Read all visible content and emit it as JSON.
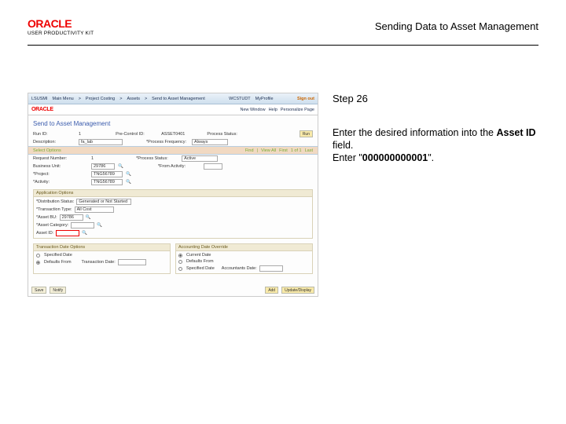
{
  "header": {
    "brand": "ORACLE",
    "product": "USER PRODUCTIVITY KIT",
    "doc_title": "Sending Data to Asset Management"
  },
  "instruction": {
    "step_label": "Step 26",
    "line1": "Enter the desired information into the ",
    "bold_field": "Asset ID",
    "line1_tail": " field.",
    "line2_pre": "Enter \"",
    "value": "000000000001",
    "line2_post": "\"."
  },
  "screenshot": {
    "topnav": {
      "a": "LSUSMI",
      "b": "Main Menu",
      "c": "Project Costing",
      "d": "Assets",
      "e": "Send to Asset Management",
      "user": "WCSTUDT",
      "prof": "MyProfile",
      "logout": "Sign out"
    },
    "brandline": {
      "right1": "New Window",
      "right2": "Help",
      "right3": "Personalize Page"
    },
    "page_title": "Send to Asset Management",
    "fields": {
      "run_lbl": "Run ID:",
      "run_val": "1",
      "prc_lbl": "Pre-Control ID:",
      "prc_val": "ASSET0401",
      "pst_lbl": "Process Status:",
      "desc_lbl": "Description:",
      "desc_val": "fa_lab",
      "pfreq_lbl": "*Process Frequency:",
      "pfreq_val": "Always",
      "run_btn": "Run"
    },
    "sel_label": "Select Options",
    "sel": {
      "find_lbl": "Find",
      "view_lbl": "View All",
      "first": "First",
      "pager": "1 of 1",
      "last": "Last",
      "requests_lbl": "Request Number:",
      "requests_val": "1",
      "pstat_lbl": "*Process Status:",
      "pstat_val": "Active",
      "bu_lbl": "Business Unit:",
      "bu_val": "29786",
      "from_lbl": "*From Activity:",
      "proj_lbl": "*Project:",
      "proj_val": "TNG56789",
      "act_lbl": "*Activity:",
      "act_val": "TNG56789"
    },
    "app_opt": "Application Options",
    "app": {
      "state_lbl": "*Distribution Status:",
      "state_val": "Generated or Not Started",
      "type_lbl": "*Transaction Type:",
      "type_val": "All Cost",
      "am_lbl": "*Asset BU:",
      "am_val": "29786",
      "ac_lbl": "*Asset Category:",
      "aid_lbl": "Asset ID:"
    },
    "left_col": "Transaction Date Options",
    "right_col": "Accounting Date Override",
    "left": {
      "o1": "Specified Date",
      "o2": "Defaults From",
      "txn_lbl": "Transaction Date:"
    },
    "right": {
      "o1": "Current Date",
      "o2": "Defaults From",
      "o3": "Specified Date",
      "acc_lbl": "Accountants Date:"
    },
    "footer": {
      "save": "Save",
      "notify": "Notify",
      "add": "Add",
      "update": "Update/Display"
    }
  }
}
